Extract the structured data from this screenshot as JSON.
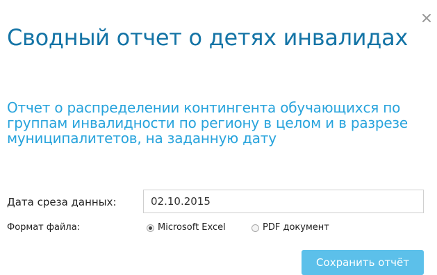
{
  "dialog": {
    "title": "Сводный отчет о детях инвалидах",
    "subtitle": "Отчет о распределении контингента обучающихся по группам инвалидности по региону в целом и в разрезе муниципалитетов, на заданную дату",
    "close_icon": "close-icon"
  },
  "form": {
    "date_label": "Дата среза данных:",
    "date_value": "02.10.2015",
    "format_label": "Формат файла:",
    "format_options": [
      {
        "label": "Microsoft Excel",
        "selected": true
      },
      {
        "label": "PDF документ",
        "selected": false
      }
    ]
  },
  "actions": {
    "save_label": "Сохранить отчёт"
  },
  "colors": {
    "title": "#1474a6",
    "subtitle": "#27a3dc",
    "button": "#5cc0ea"
  }
}
